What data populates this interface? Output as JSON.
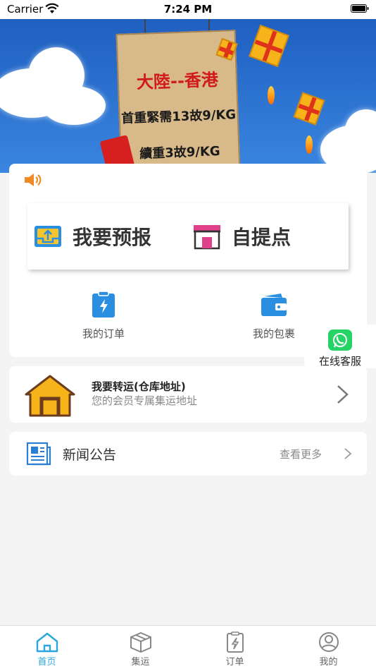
{
  "status_bar": {
    "carrier": "Carrier",
    "time": "7:24 PM"
  },
  "banner": {
    "line1": "大陸--香港",
    "line2": "首重緊需13故9/KG",
    "line3": "續重3故9/KG"
  },
  "quick_actions": [
    {
      "label": "我要预报",
      "icon": "upload-tray-icon"
    },
    {
      "label": "自提点",
      "icon": "store-icon"
    }
  ],
  "shortcuts": [
    {
      "label": "我的订单",
      "icon": "order-clipboard-icon"
    },
    {
      "label": "我的包裹",
      "icon": "wallet-icon"
    }
  ],
  "float_service": {
    "label": "在线客服",
    "icon": "whatsapp-icon"
  },
  "transfer": {
    "title": "我要转运(仓库地址)",
    "subtitle": "您的会员专属集运地址"
  },
  "news": {
    "title": "新闻公告",
    "more": "查看更多"
  },
  "tabs": [
    {
      "label": "首页",
      "active": true
    },
    {
      "label": "集运",
      "active": false
    },
    {
      "label": "订单",
      "active": false
    },
    {
      "label": "我的",
      "active": false
    }
  ],
  "colors": {
    "accent": "#2aa5e0",
    "banner_blue": "#2e73d0"
  }
}
